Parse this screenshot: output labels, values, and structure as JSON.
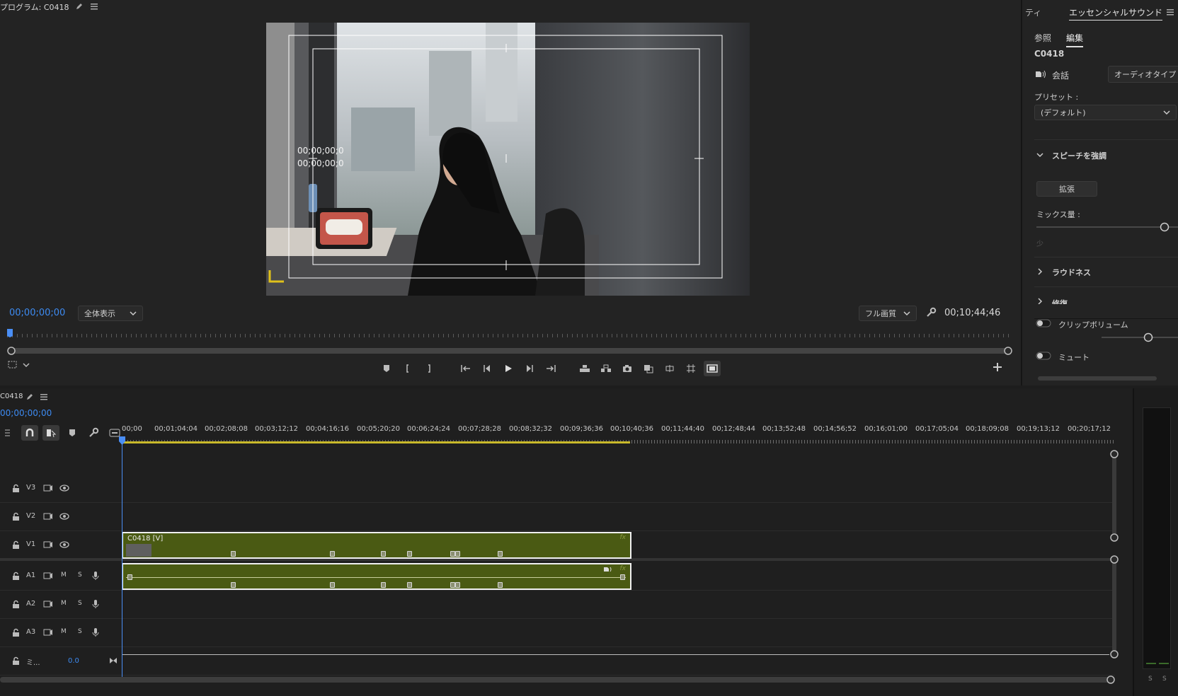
{
  "monitor": {
    "title": "プログラム: C0418",
    "current_timecode": "00;00;00;00",
    "zoom_option": "全体表示",
    "quality_option": "フル画質",
    "duration_timecode": "00;10;44;46",
    "overlay_timecode_1": "00;00;00;0",
    "overlay_timecode_2": "00;00;00;0"
  },
  "essential_sound": {
    "tab_left": "ティ",
    "panel_title": "エッセンシャルサウンド",
    "tabs": [
      "参照",
      "編集"
    ],
    "active_tab": "編集",
    "clip_name": "C0418",
    "type_label": "会話",
    "audio_type_button": "オーディオタイプ",
    "preset_label": "プリセット :",
    "preset_value": "(デフォルト)",
    "speech_section": "スピーチを強調",
    "enhance_button": "拡張",
    "mix_label": "ミックス量 :",
    "mix_low_label": "少",
    "loudness_section": "ラウドネス",
    "repair_section": "修復",
    "clip_volume_label": "クリップボリューム",
    "mute_label": "ミュート"
  },
  "timeline": {
    "sequence_name": "C0418",
    "current_timecode": "00;00;00;00",
    "ruler_labels": [
      "00;00",
      "00;01;04;04",
      "00;02;08;08",
      "00;03;12;12",
      "00;04;16;16",
      "00;05;20;20",
      "00;06;24;24",
      "00;07;28;28",
      "00;08;32;32",
      "00;09;36;36",
      "00;10;40;36",
      "00;11;44;40",
      "00;12;48;44",
      "00;13;52;48",
      "00;14;56;52",
      "00;16;01;00",
      "00;17;05;04",
      "00;18;09;08",
      "00;19;13;12",
      "00;20;17;12"
    ],
    "tracks": {
      "v3": "V3",
      "v2": "V2",
      "v1": "V1",
      "a1": "A1",
      "a2": "A2",
      "a3": "A3",
      "mute_letter": "M",
      "solo_letter": "S",
      "master_label": "ミ...",
      "master_value": "0.0"
    },
    "video_clip_label": "C0418 [V]",
    "clip_fx": "fx"
  },
  "meter": {
    "solo_left": "S",
    "solo_right": "S"
  }
}
